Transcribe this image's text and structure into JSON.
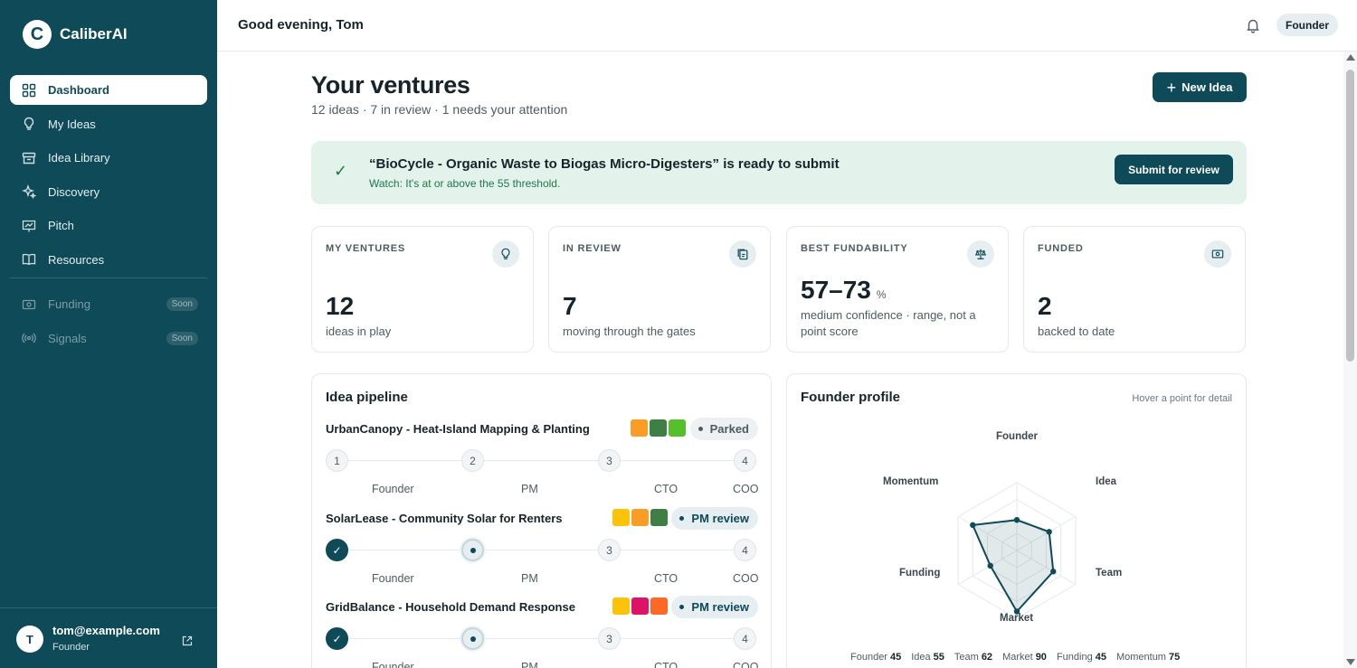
{
  "brand": {
    "logo_letter": "C",
    "name": "CaliberAI"
  },
  "sidebar": {
    "items": [
      {
        "label": "Dashboard",
        "icon": "grid-icon",
        "active": true
      },
      {
        "label": "My Ideas",
        "icon": "lightbulb-icon"
      },
      {
        "label": "Idea Library",
        "icon": "archive-icon"
      },
      {
        "label": "Discovery",
        "icon": "sparkles-icon"
      },
      {
        "label": "Pitch",
        "icon": "presentation-chart-icon"
      },
      {
        "label": "Resources",
        "icon": "book-icon"
      }
    ],
    "soon_items": [
      {
        "label": "Funding",
        "icon": "banknote-icon",
        "badge": "Soon"
      },
      {
        "label": "Signals",
        "icon": "radio-signal-icon",
        "badge": "Soon"
      }
    ],
    "user": {
      "initial": "T",
      "email": "tom@example.com",
      "role": "Founder"
    }
  },
  "header": {
    "greeting": "Good evening, Tom",
    "role_pill": "Founder"
  },
  "page": {
    "title": "Your ventures",
    "subtitle": "12 ideas · 7 in review · 1 needs your attention",
    "new_idea_label": "New Idea"
  },
  "banner": {
    "title": "“BioCycle - Organic Waste to Biogas Micro-Digesters” is ready to submit",
    "note": "Watch: It's at or above the 55 threshold.",
    "button": "Submit for review"
  },
  "stats": [
    {
      "label": "MY VENTURES",
      "value": "12",
      "unit": "",
      "desc": "ideas in play",
      "icon": "lightbulb-icon"
    },
    {
      "label": "IN REVIEW",
      "value": "7",
      "unit": "",
      "desc": "moving through the gates",
      "icon": "clipboard-copy-icon"
    },
    {
      "label": "BEST FUNDABILITY",
      "value": "57–73",
      "unit": "%",
      "desc": "medium confidence · range, not a point score",
      "icon": "scale-icon"
    },
    {
      "label": "FUNDED",
      "value": "2",
      "unit": "",
      "desc": "backed to date",
      "icon": "banknote-icon"
    }
  ],
  "pipeline": {
    "title": "Idea pipeline",
    "stage_labels": [
      "Founder",
      "PM",
      "CTO",
      "COO"
    ],
    "ideas": [
      {
        "name": "UrbanCanopy - Heat-Island Mapping & Planting",
        "status": "Parked",
        "sdg_colors": [
          "#f99d26",
          "#3f7e44",
          "#56c02b"
        ],
        "progress": [
          1,
          2,
          3,
          4
        ]
      },
      {
        "name": "SolarLease - Community Solar for Renters",
        "status": "PM review",
        "sdg_colors": [
          "#fcc30b",
          "#f99d26",
          "#3f7e44"
        ],
        "progress": [
          "done",
          "current",
          3,
          4
        ]
      },
      {
        "name": "GridBalance - Household Demand Response",
        "status": "PM review",
        "sdg_colors": [
          "#fcc30b",
          "#dd1367",
          "#fd6925"
        ],
        "progress": [
          "done",
          "current",
          3,
          4
        ]
      }
    ]
  },
  "profile": {
    "title": "Founder profile",
    "hint": "Hover a point for detail",
    "accent": "#0e4a58",
    "axes": [
      "Founder",
      "Idea",
      "Team",
      "Market",
      "Funding",
      "Momentum"
    ],
    "values": [
      45,
      55,
      62,
      90,
      45,
      75
    ],
    "max": 100
  }
}
